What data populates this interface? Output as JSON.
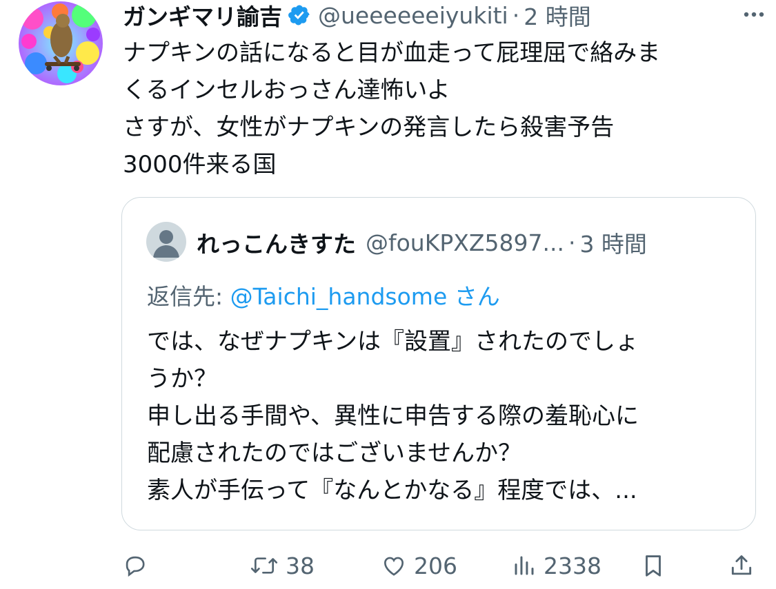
{
  "tweet": {
    "display_name": "ガンギマリ諭吉",
    "handle": "@ueeeeeeiyukiti",
    "separator": "·",
    "time": "2 時間",
    "text": "ナプキンの話になると目が血走って屁理屈で絡みま\nくるインセルおっさん達怖いよ\nさすが、女性がナプキンの発言したら殺害予告\n3000件来る国",
    "verified": true
  },
  "quote": {
    "display_name": "れっこんきすた",
    "handle": "@fouKPXZ5897...",
    "separator": "·",
    "time": "3 時間",
    "reply_label": "返信先: ",
    "reply_handle": "@Taichi_handsome",
    "reply_suffix": " さん",
    "text": "では、なぜナプキンは『設置』されたのでしょ\nうか？\n申し出る手間や、異性に申告する際の羞恥心に\n配慮されたのではございませんか？\n素人が手伝って『なんとかなる』程度では、..."
  },
  "actions": {
    "reply_count": "",
    "retweet_count": "38",
    "like_count": "206",
    "view_count": "2338"
  },
  "icons": {
    "verified": "verified-badge-icon",
    "more": "more-dots-icon",
    "reply": "reply-icon",
    "retweet": "retweet-icon",
    "like": "heart-icon",
    "views": "views-bar-icon",
    "bookmark": "bookmark-icon",
    "share": "share-icon"
  },
  "colors": {
    "text": "#0f1419",
    "secondary": "#536471",
    "link": "#1d9bf0",
    "border": "#cfd9de",
    "verified": "#1d9bf0"
  }
}
